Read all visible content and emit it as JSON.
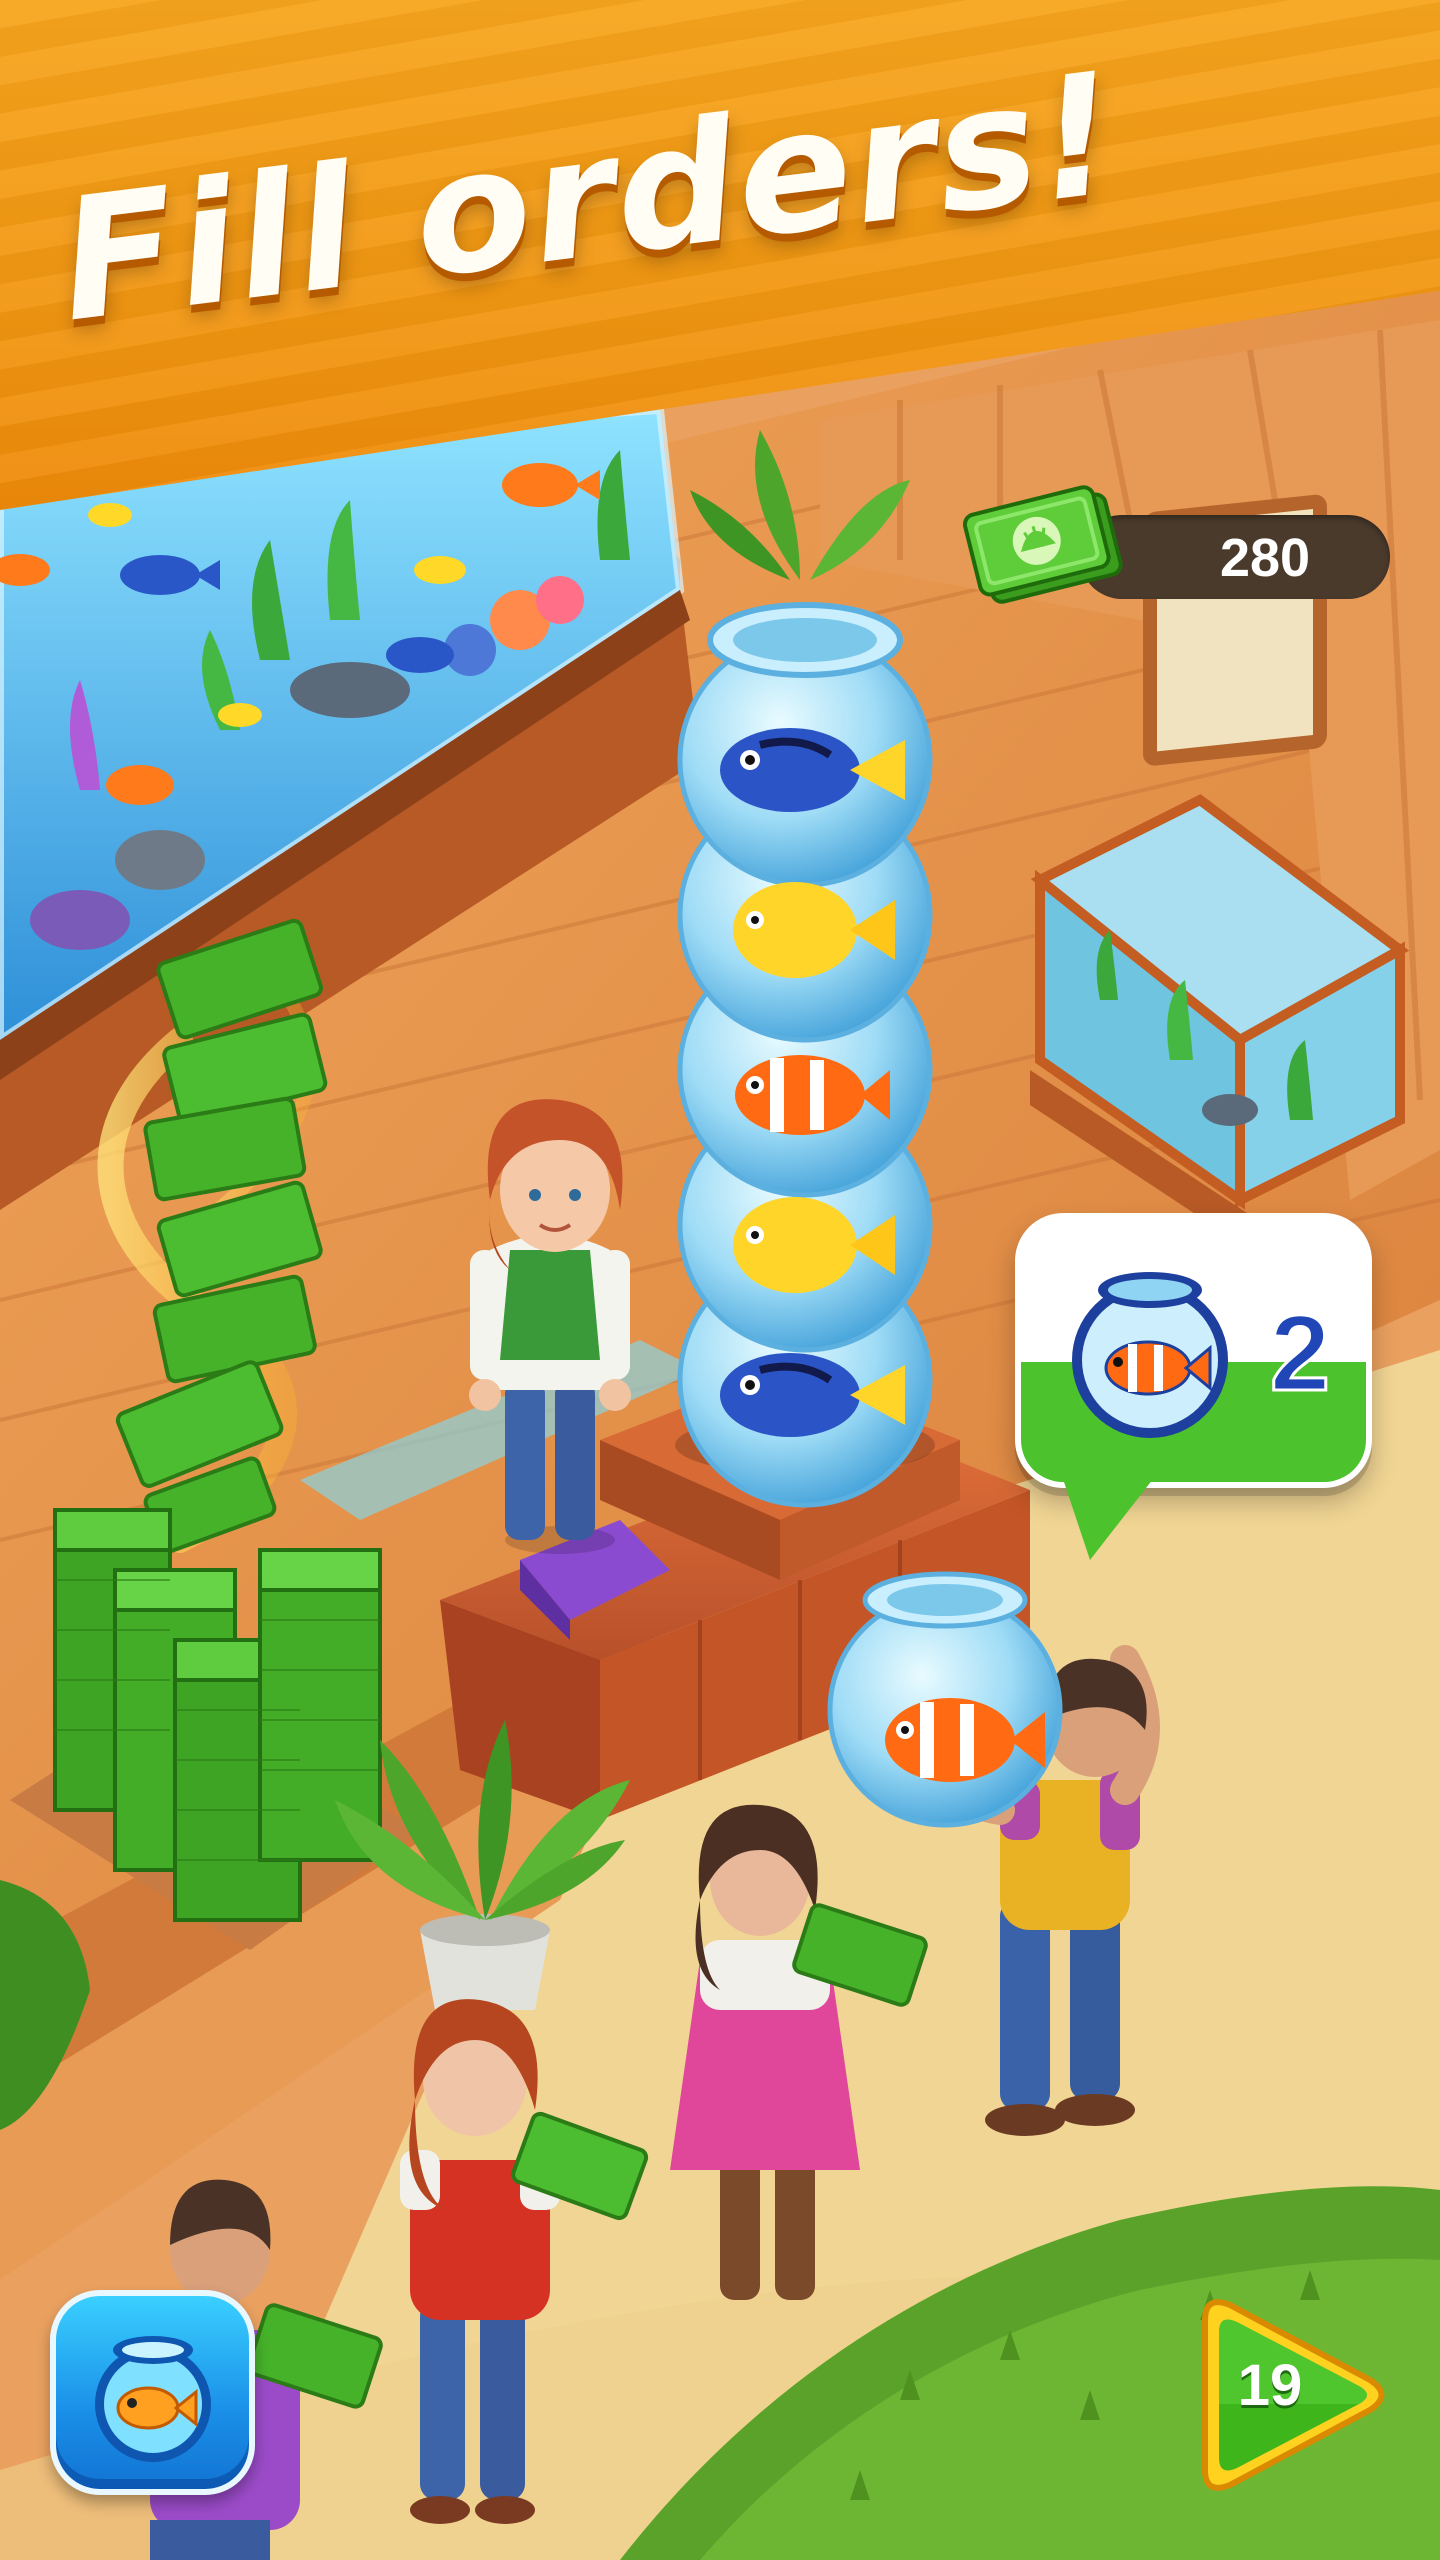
{
  "banner": {
    "title": "Fill orders!"
  },
  "currency": {
    "amount": "280",
    "icon": "cash-icon"
  },
  "order": {
    "count": "2",
    "icon": "fishbowl-clownfish-icon"
  },
  "buttons": {
    "aquarium": {
      "icon": "fishbowl-icon"
    },
    "play": {
      "level": "19",
      "icon": "play-arrow-icon"
    }
  },
  "colors": {
    "banner": "#f29a14",
    "currency_bar": "#4a3a2c",
    "order_green": "#4cc22c",
    "order_number": "#2046b8",
    "aquarium_button": "#1a8fe8",
    "play_button": "#3fb51c"
  }
}
